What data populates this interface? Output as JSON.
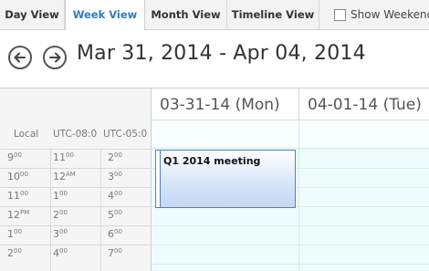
{
  "tabs": [
    {
      "label": "Day View",
      "active": false
    },
    {
      "label": "Week View",
      "active": true
    },
    {
      "label": "Month View",
      "active": false
    },
    {
      "label": "Timeline View",
      "active": false
    }
  ],
  "show_weekend": {
    "label": "Show Weekend",
    "checked": false
  },
  "header": {
    "range_title": "Mar 31, 2014 - Apr 04, 2014"
  },
  "timezones": [
    "Local",
    "UTC-08:0",
    "UTC-05:0"
  ],
  "time_rows": [
    {
      "local": [
        "9",
        "00"
      ],
      "utc8": [
        "11",
        "00"
      ],
      "utc5": [
        "2",
        "00"
      ]
    },
    {
      "local": [
        "10",
        "00"
      ],
      "utc8": [
        "12",
        "AM"
      ],
      "utc5": [
        "3",
        "00"
      ]
    },
    {
      "local": [
        "11",
        "00"
      ],
      "utc8": [
        "1",
        "00"
      ],
      "utc5": [
        "4",
        "00"
      ]
    },
    {
      "local": [
        "12",
        "PM"
      ],
      "utc8": [
        "2",
        "00"
      ],
      "utc5": [
        "5",
        "00"
      ]
    },
    {
      "local": [
        "1",
        "00"
      ],
      "utc8": [
        "3",
        "00"
      ],
      "utc5": [
        "6",
        "00"
      ]
    },
    {
      "local": [
        "2",
        "00"
      ],
      "utc8": [
        "4",
        "00"
      ],
      "utc5": [
        "7",
        "00"
      ]
    }
  ],
  "days": [
    {
      "label": "03-31-14 (Mon)"
    },
    {
      "label": "04-01-14 (Tue)"
    }
  ],
  "appointment": {
    "title": "Q1 2014 meeting"
  },
  "colors": {
    "accent": "#2b7cc7",
    "day_bg": "#eefcfc",
    "appointment_border": "#5a7fb4"
  }
}
